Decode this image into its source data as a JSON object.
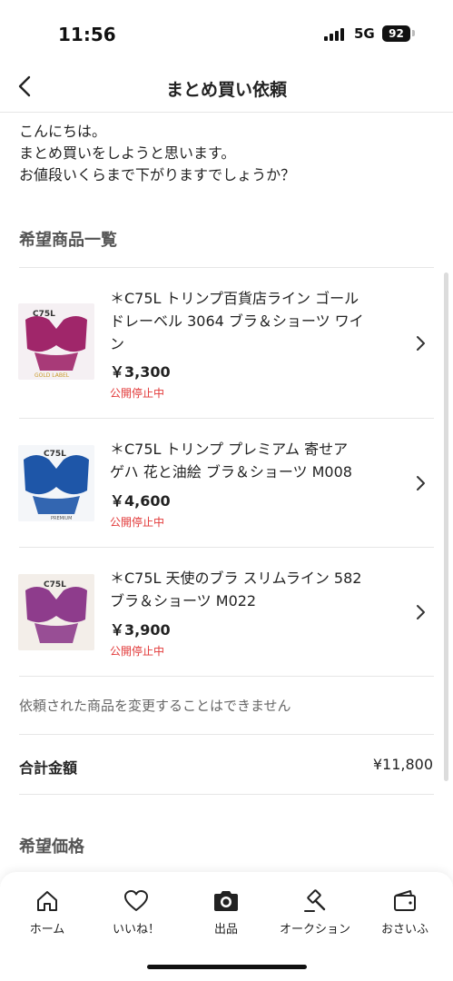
{
  "status_bar": {
    "time": "11:56",
    "network": "5G",
    "battery": "92"
  },
  "nav": {
    "title": "まとめ買い依頼"
  },
  "message": {
    "lines": [
      "こんにちは。",
      "まとめ買いをしようと思います。",
      "お値段いくらまで下がりますでしょうか？"
    ]
  },
  "items_heading": "希望商品一覧",
  "items": [
    {
      "title_lines": [
        "＊C75L トリンプ百貨店ライン ゴール",
        "ドレーベル 3064 ブラ＆ショーツ ワイ",
        "ン"
      ],
      "price": "￥3,300",
      "status": "公開停止中",
      "thumb_text": "C75L",
      "thumb_caption": "GOLD LABEL",
      "thumb_color": "#a0266a"
    },
    {
      "title_lines": [
        "＊C75L トリンプ プレミアム 寄せア",
        "ゲハ 花と油絵 ブラ＆ショーツ M008"
      ],
      "price": "￥4,600",
      "status": "公開停止中",
      "thumb_text": "C75L",
      "thumb_caption": "PREMIUM",
      "thumb_color": "#1e56a8"
    },
    {
      "title_lines": [
        "＊C75L 天使のブラ スリムライン 582",
        "ブラ＆ショーツ M022"
      ],
      "price": "￥3,900",
      "status": "公開停止中",
      "thumb_text": "C75L",
      "thumb_caption": "",
      "thumb_color": "#8e3c8c"
    }
  ],
  "note": "依頼された商品を変更することはできません",
  "total": {
    "label": "合計金額",
    "value": "¥11,800"
  },
  "price_heading": "希望価格",
  "tabs": [
    {
      "label": "ホーム",
      "icon": "home-icon"
    },
    {
      "label": "いいね！",
      "icon": "heart-icon"
    },
    {
      "label": "出品",
      "icon": "camera-icon"
    },
    {
      "label": "オークション",
      "icon": "gavel-icon"
    },
    {
      "label": "おさいふ",
      "icon": "wallet-icon"
    }
  ],
  "colors": {
    "status_red": "#e23838",
    "text": "#222222",
    "divider": "#e6e6e6"
  }
}
